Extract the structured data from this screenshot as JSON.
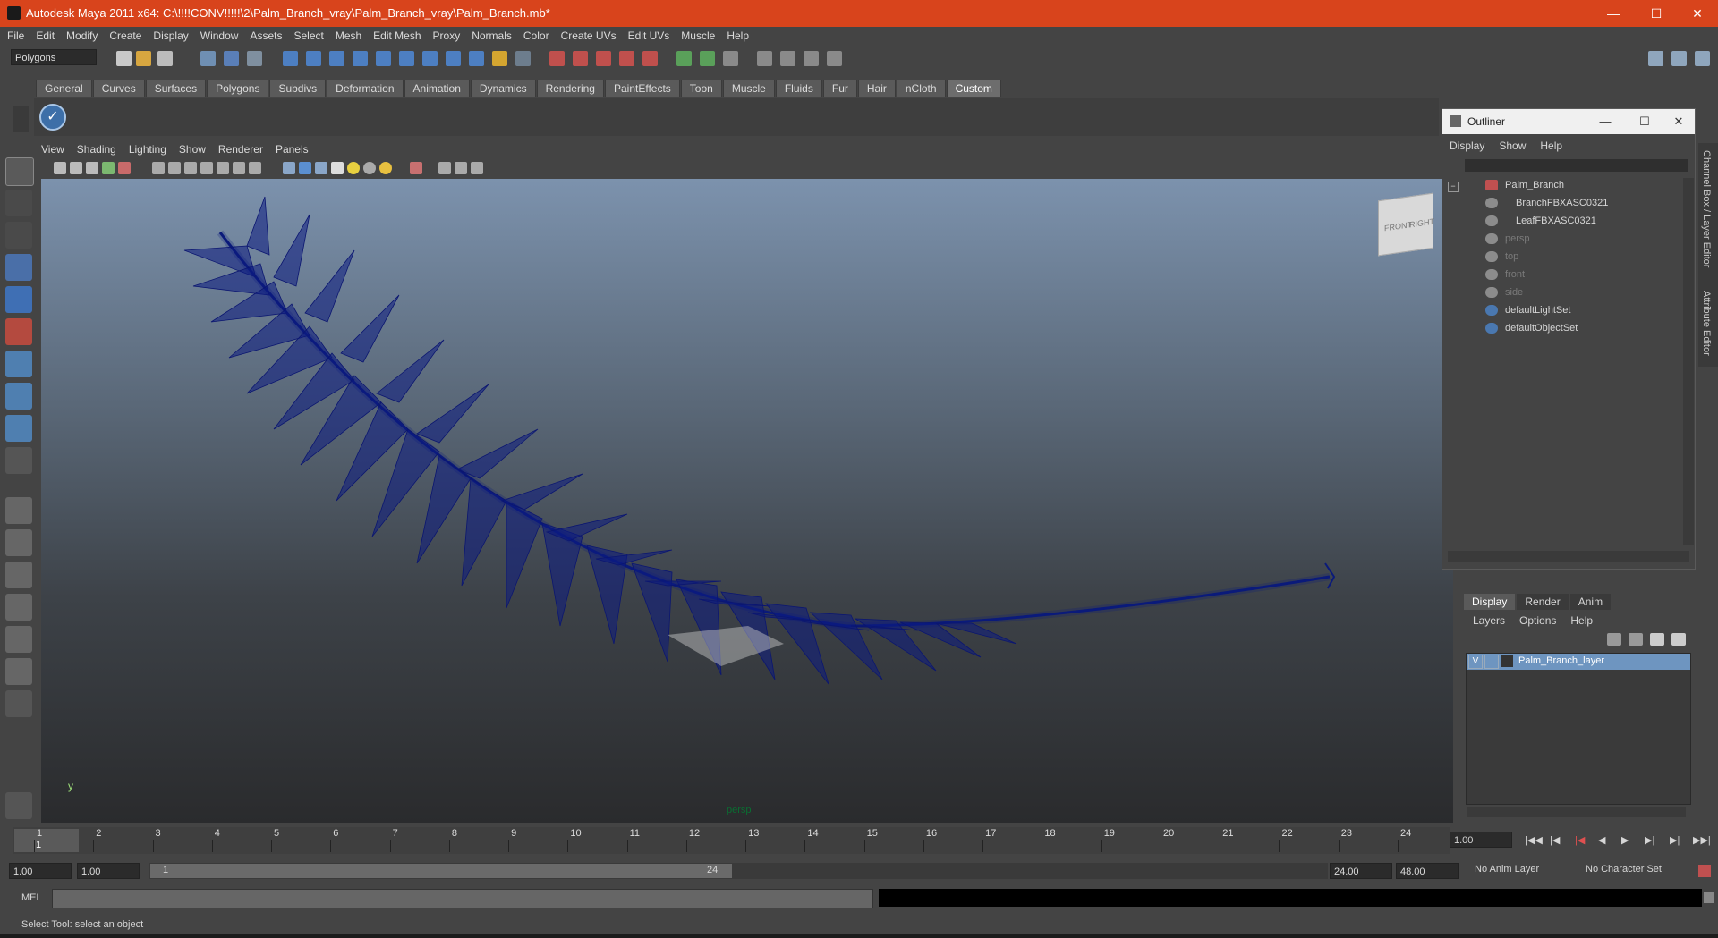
{
  "window": {
    "title": "Autodesk Maya 2011 x64: C:\\!!!!CONV!!!!!\\2\\Palm_Branch_vray\\Palm_Branch_vray\\Palm_Branch.mb*",
    "minimize": "—",
    "maximize": "☐",
    "close": "✕"
  },
  "menubar": [
    "File",
    "Edit",
    "Modify",
    "Create",
    "Display",
    "Window",
    "Assets",
    "Select",
    "Mesh",
    "Edit Mesh",
    "Proxy",
    "Normals",
    "Color",
    "Create UVs",
    "Edit UVs",
    "Muscle",
    "Help"
  ],
  "status": {
    "mode": "Polygons"
  },
  "shelf": {
    "tabs": [
      "General",
      "Curves",
      "Surfaces",
      "Polygons",
      "Subdivs",
      "Deformation",
      "Animation",
      "Dynamics",
      "Rendering",
      "PaintEffects",
      "Toon",
      "Muscle",
      "Fluids",
      "Fur",
      "Hair",
      "nCloth",
      "Custom"
    ],
    "active": "Custom"
  },
  "panel": {
    "menu": [
      "View",
      "Shading",
      "Lighting",
      "Show",
      "Renderer",
      "Panels"
    ],
    "camera": "persp",
    "axis": "y",
    "viewcube": {
      "front": "FRONT",
      "right": "RIGHT"
    }
  },
  "outliner": {
    "title": "Outliner",
    "menu": [
      "Display",
      "Show",
      "Help"
    ],
    "items": [
      {
        "label": "Palm_Branch",
        "indent": 0,
        "dim": false,
        "icon": "transform-icon"
      },
      {
        "label": "BranchFBXASC0321",
        "indent": 1,
        "dim": false,
        "icon": "mesh-icon"
      },
      {
        "label": "LeafFBXASC0321",
        "indent": 1,
        "dim": false,
        "icon": "mesh-icon"
      },
      {
        "label": "persp",
        "indent": 0,
        "dim": true,
        "icon": "camera-icon"
      },
      {
        "label": "top",
        "indent": 0,
        "dim": true,
        "icon": "camera-icon"
      },
      {
        "label": "front",
        "indent": 0,
        "dim": true,
        "icon": "camera-icon"
      },
      {
        "label": "side",
        "indent": 0,
        "dim": true,
        "icon": "camera-icon"
      },
      {
        "label": "defaultLightSet",
        "indent": 0,
        "dim": false,
        "icon": "set-icon"
      },
      {
        "label": "defaultObjectSet",
        "indent": 0,
        "dim": false,
        "icon": "set-icon"
      }
    ]
  },
  "sidetabs": [
    "Channel Box / Layer Editor",
    "Attribute Editor"
  ],
  "layers": {
    "tabs": [
      "Display",
      "Render",
      "Anim"
    ],
    "active": "Display",
    "menu": [
      "Layers",
      "Options",
      "Help"
    ],
    "layer_name": "Palm_Branch_layer",
    "visible_flag": "V"
  },
  "timeline": {
    "ticks": [
      "1",
      "2",
      "3",
      "4",
      "5",
      "6",
      "7",
      "8",
      "9",
      "10",
      "11",
      "12",
      "13",
      "14",
      "15",
      "16",
      "17",
      "18",
      "19",
      "20",
      "21",
      "22",
      "23",
      "24"
    ],
    "current_frame": "1",
    "current_time_field": "1.00"
  },
  "range": {
    "start": "1.00",
    "anim_start": "1.00",
    "range_start_label": "1",
    "range_end_label": "24",
    "end": "24.00",
    "anim_end": "48.00",
    "anim_layer": "No Anim Layer",
    "character_set": "No Character Set"
  },
  "commandline": {
    "label": "MEL"
  },
  "helpline": {
    "text": "Select Tool: select an object"
  }
}
